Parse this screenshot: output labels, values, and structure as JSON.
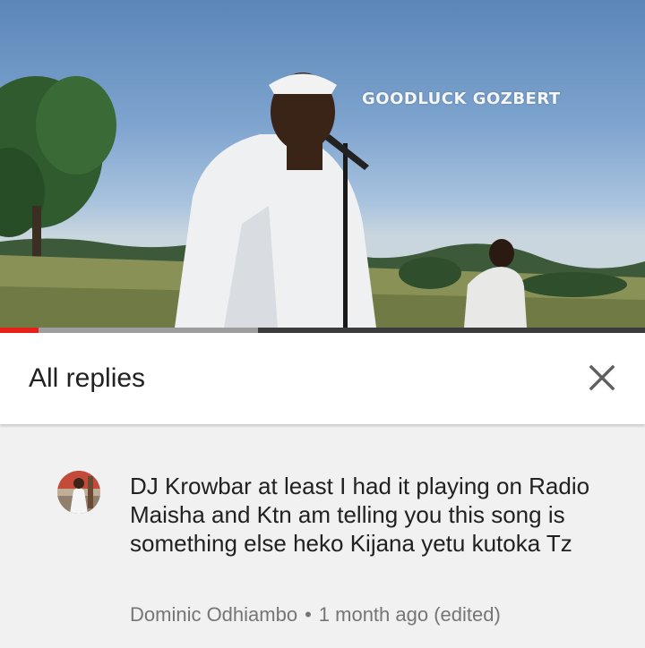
{
  "video": {
    "overlay_title": "GOODLUCK GOZBERT",
    "progress": {
      "played_fraction": 0.06,
      "buffered_fraction": 0.4
    },
    "colors": {
      "progress_played": "#e62117",
      "progress_buffer": "#9e9e9e"
    }
  },
  "replies_panel": {
    "title": "All replies",
    "close_icon": "close-icon"
  },
  "comment": {
    "text": "DJ Krowbar at least I had it playing on Radio Maisha and Ktn am telling you this song is something else heko Kijana yetu kutoka Tz",
    "author": "Dominic Odhiambo",
    "separator": "•",
    "time": "1 month ago (edited)"
  }
}
